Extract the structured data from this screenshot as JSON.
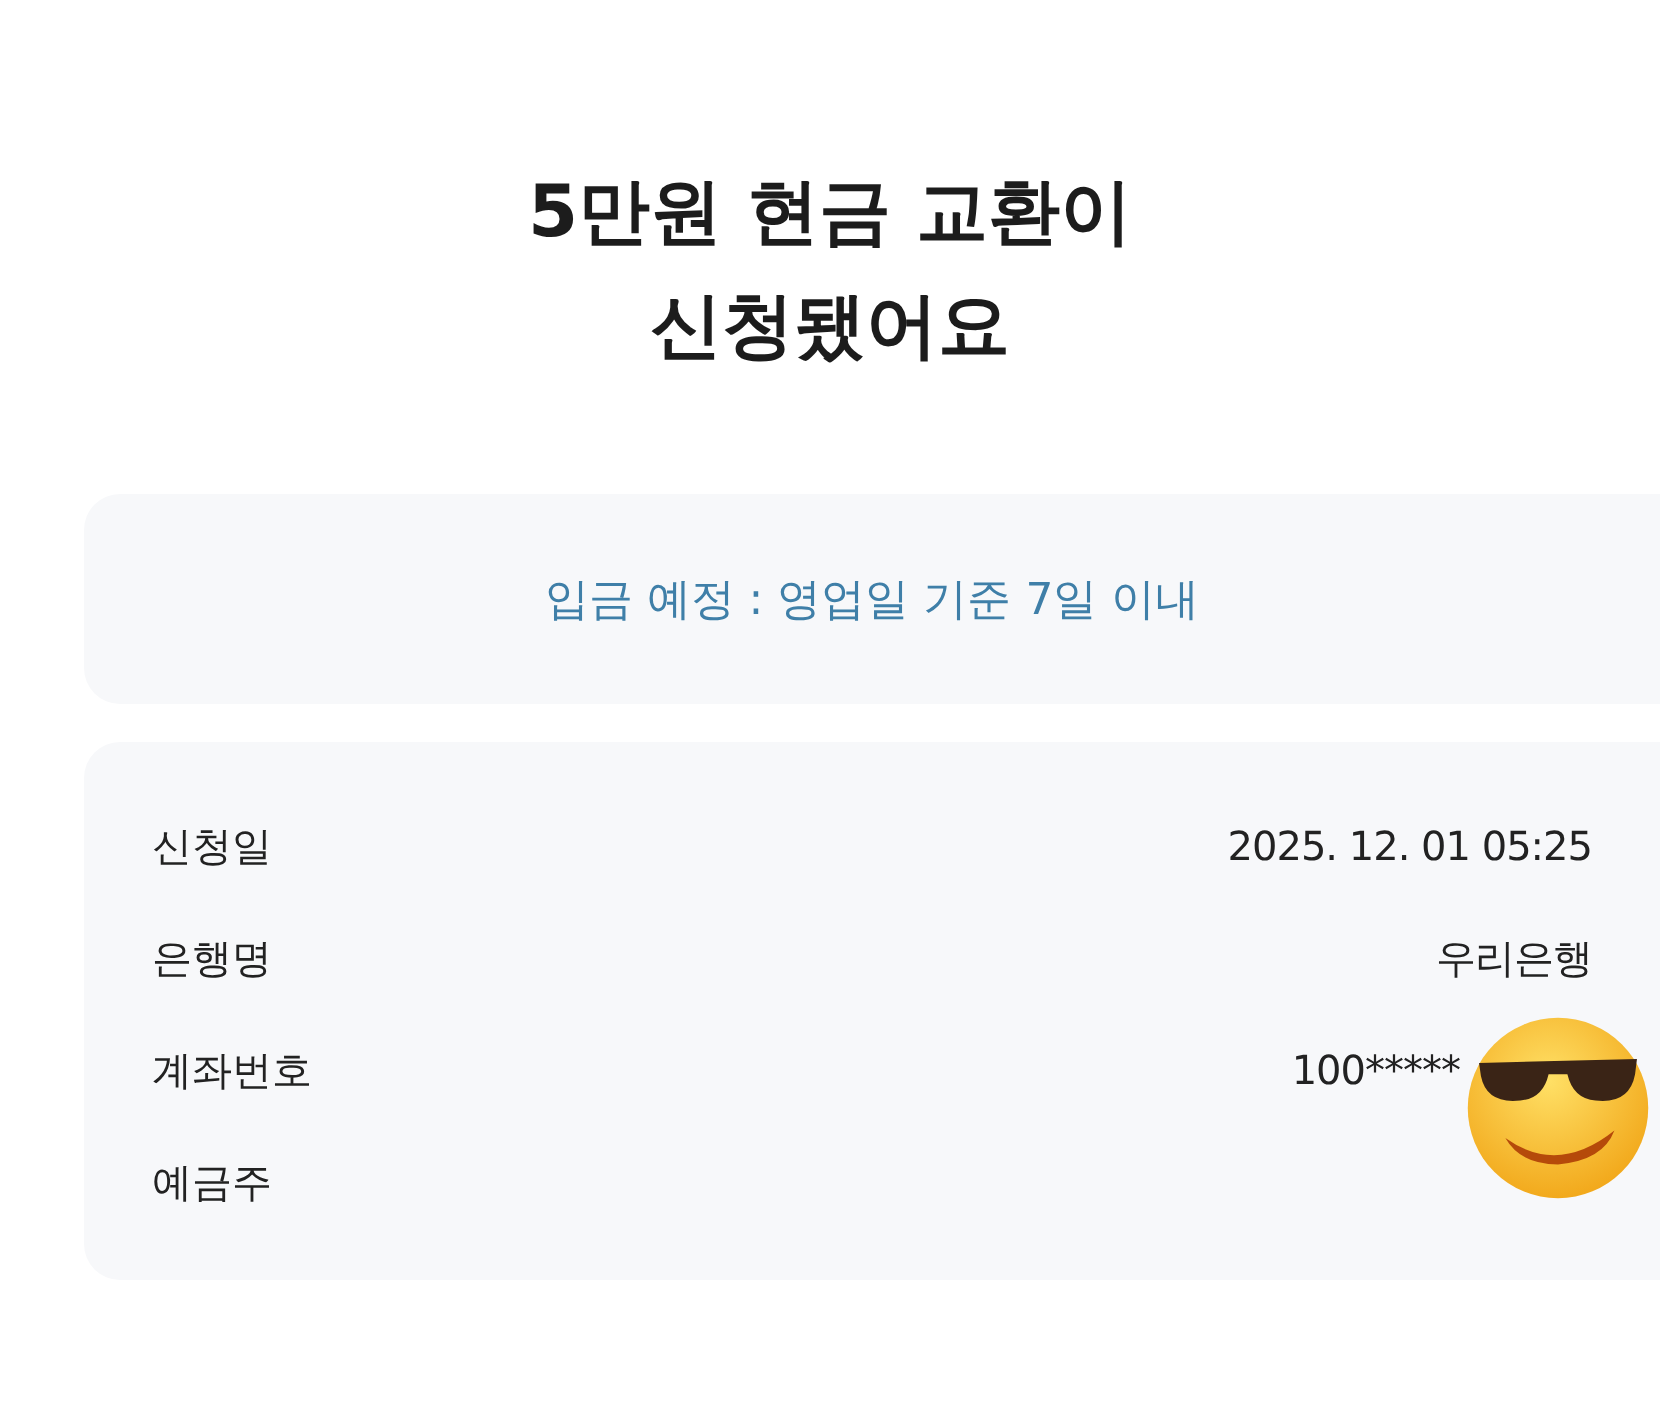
{
  "title_lines": [
    "5만원 현금 교환이",
    "신청됐어요"
  ],
  "notice": "입금 예정 : 영업일 기준 7일 이내",
  "details": [
    {
      "label": "신청일",
      "value": "2025. 12. 01 05:25"
    },
    {
      "label": "은행명",
      "value": "우리은행"
    },
    {
      "label": "계좌번호",
      "value": "100*****",
      "sticker": {
        "kind": "emoji"
      }
    },
    {
      "label": "예금주"
    }
  ]
}
